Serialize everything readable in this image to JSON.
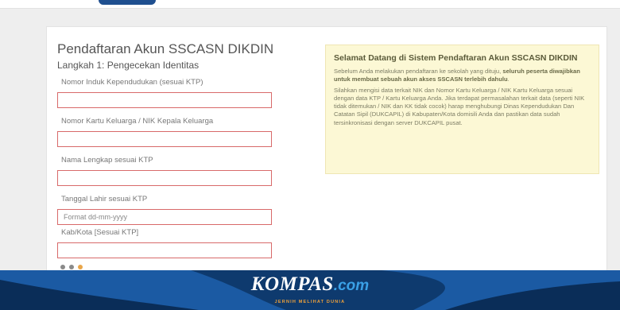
{
  "form": {
    "title": "Pendaftaran Akun SSCASN DIKDIN",
    "subtitle": "Langkah 1: Pengecekan Identitas",
    "fields": [
      {
        "label": "Nomor Induk Kependudukan (sesuai KTP)",
        "value": "",
        "placeholder": ""
      },
      {
        "label": "Nomor Kartu Keluarga / NIK Kepala Keluarga",
        "value": "",
        "placeholder": ""
      },
      {
        "label": "Nama Lengkap sesuai KTP",
        "value": "",
        "placeholder": ""
      },
      {
        "label": "Tanggal Lahir sesuai KTP",
        "value": "",
        "placeholder": "Format dd-mm-yyyy"
      },
      {
        "label": "Kab/Kota [Sesuai KTP]",
        "value": "",
        "placeholder": ""
      }
    ]
  },
  "info": {
    "title": "Selamat Datang di Sistem Pendaftaran Akun SSCASN DIKDIN",
    "para1_normal": "Sebelum Anda melakukan pendaftaran ke sekolah yang dituju, ",
    "para1_bold": "seluruh peserta diwajibkan untuk membuat sebuah akun akses SSCASN terlebih dahulu",
    "para1_end": ".",
    "para2": "Silahkan mengisi data terkait NIK dan Nomor Kartu Keluarga / NIK Kartu Keluarga sesuai dengan data KTP / Kartu Keluarga Anda. Jika terdapat permasalahan terkait data (seperti NIK tidak ditemukan / NIK dan KK tidak cocok) harap menghubungi Dinas Kependudukan Dan Catatan Sipil (DUKCAPIL) di Kabupaten/Kota domisili Anda dan pastikan data sudah tersinkronisasi dengan server DUKCAPIL pusat."
  },
  "watermark": {
    "brand": "KOMPAS",
    "suffix": ".com",
    "tagline": "JERNIH MELIHAT DUNIA"
  },
  "colors": {
    "input_border": "#d86a6a",
    "info_background": "#fcf8d5",
    "footer_blue": "#0e3a6e",
    "brand_accent": "#3aa0e6",
    "tagline_orange": "#f0a23a"
  }
}
